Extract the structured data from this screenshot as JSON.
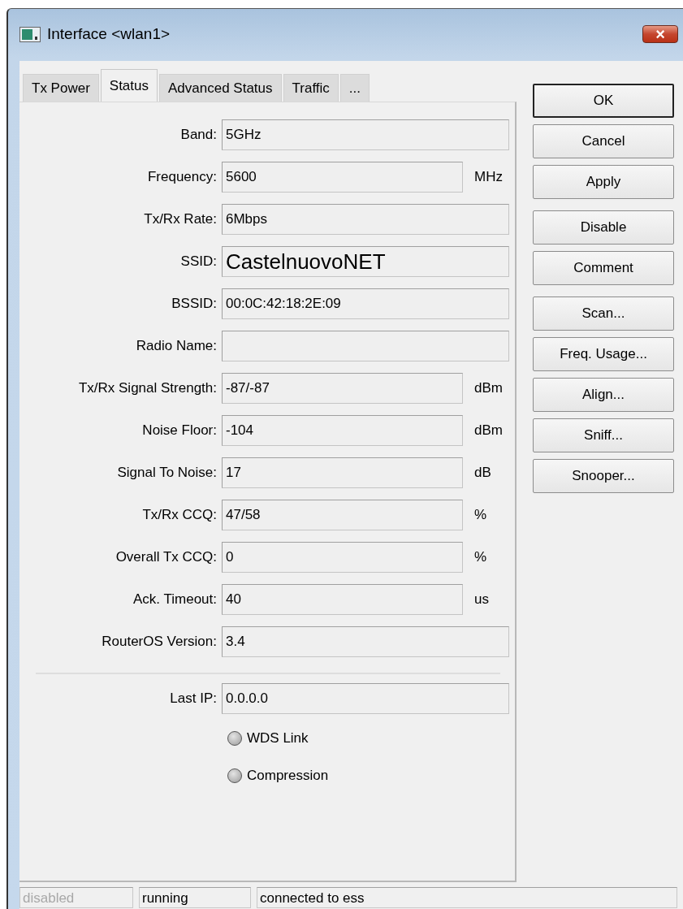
{
  "window": {
    "title": "Interface <wlan1>",
    "close": "×"
  },
  "tabs": [
    {
      "label": "Tx Power",
      "selected": false
    },
    {
      "label": "Status",
      "selected": true
    },
    {
      "label": "Advanced Status",
      "selected": false
    },
    {
      "label": "Traffic",
      "selected": false
    },
    {
      "label": "...",
      "selected": false
    }
  ],
  "fields": [
    {
      "label": "Band:",
      "value": "5GHz",
      "kind": "text"
    },
    {
      "label": "Frequency:",
      "value": "5600",
      "unit": "MHz",
      "kind": "text"
    },
    {
      "label": "Tx/Rx Rate:",
      "value": "6Mbps",
      "kind": "text"
    },
    {
      "label": "SSID:",
      "value": "CastelnuovoNET",
      "kind": "large"
    },
    {
      "label": "BSSID:",
      "value": "00:0C:42:18:2E:09",
      "kind": "text"
    },
    {
      "label": "Radio Name:",
      "kind": "text"
    },
    {
      "label": "Tx/Rx Signal Strength:",
      "value": "-87/-87",
      "unit": "dBm",
      "kind": "text"
    },
    {
      "label": "Noise Floor:",
      "value": "-104",
      "unit": "dBm",
      "kind": "text"
    },
    {
      "label": "Signal To Noise:",
      "value": "17",
      "unit": "dB",
      "kind": "text"
    },
    {
      "label": "Tx/Rx CCQ:",
      "value": "47/58",
      "unit": "%",
      "kind": "text"
    },
    {
      "label": "Overall Tx CCQ:",
      "value": "0",
      "unit": "%",
      "kind": "text"
    },
    {
      "label": "Ack. Timeout:",
      "value": "40",
      "unit": "us",
      "kind": "text"
    },
    {
      "label": "RouterOS Version:",
      "value": "3.4",
      "kind": "text"
    }
  ],
  "fields_2": [
    {
      "label": "Last IP:",
      "value": "0.0.0.0",
      "kind": "text"
    }
  ],
  "indicators": [
    {
      "label": "WDS Link",
      "on": false
    },
    {
      "label": "Compression",
      "on": false
    }
  ],
  "button_groups": [
    [
      {
        "label": "OK",
        "default": true
      },
      {
        "label": "Cancel",
        "default": false
      },
      {
        "label": "Apply",
        "default": false
      }
    ],
    [
      {
        "label": "Disable",
        "default": false
      },
      {
        "label": "Comment",
        "default": false
      }
    ],
    [
      {
        "label": "Scan...",
        "default": false
      },
      {
        "label": "Freq. Usage...",
        "default": false
      },
      {
        "label": "Align...",
        "default": false
      },
      {
        "label": "Sniff...",
        "default": false
      },
      {
        "label": "Snooper...",
        "default": false
      }
    ]
  ],
  "status_bar": [
    {
      "text": "disabled",
      "dimmed": true
    },
    {
      "text": "running",
      "dimmed": false
    },
    {
      "text": "connected to ess",
      "dimmed": false
    }
  ]
}
